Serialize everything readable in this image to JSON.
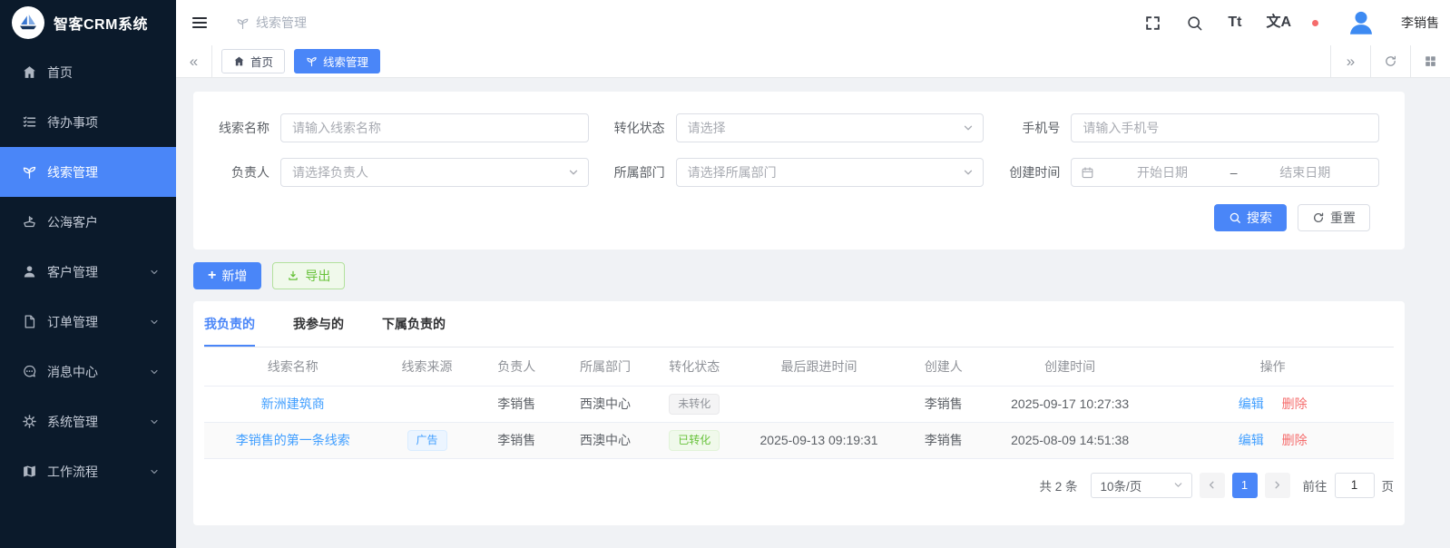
{
  "colors": {
    "primary": "#4a86f8",
    "link": "#409eff",
    "success": "#67c23a",
    "danger": "#f56c6c",
    "sidebar_bg": "#0b1a2b",
    "page_bg": "#f0f2f5"
  },
  "app": {
    "title": "智客CRM系统",
    "logo_icon": "sailboat-icon"
  },
  "sidebar": {
    "items": [
      {
        "label": "首页",
        "icon": "home-icon",
        "active": false,
        "expandable": false
      },
      {
        "label": "待办事项",
        "icon": "todo-list-icon",
        "active": false,
        "expandable": false
      },
      {
        "label": "线索管理",
        "icon": "seedling-icon",
        "active": true,
        "expandable": false
      },
      {
        "label": "公海客户",
        "icon": "ship-icon",
        "active": false,
        "expandable": false
      },
      {
        "label": "客户管理",
        "icon": "user-icon",
        "active": false,
        "expandable": true
      },
      {
        "label": "订单管理",
        "icon": "document-icon",
        "active": false,
        "expandable": true
      },
      {
        "label": "消息中心",
        "icon": "chat-icon",
        "active": false,
        "expandable": true
      },
      {
        "label": "系统管理",
        "icon": "gear-icon",
        "active": false,
        "expandable": true
      },
      {
        "label": "工作流程",
        "icon": "workflow-map-icon",
        "active": false,
        "expandable": true
      }
    ]
  },
  "header": {
    "breadcrumb": "线索管理",
    "font_icon_text": "Tt",
    "lang_icon_text": "文A",
    "username": "李销售",
    "icons": [
      "fullscreen-icon",
      "search-icon",
      "font-size-icon",
      "language-icon",
      "bell-icon",
      "avatar"
    ]
  },
  "tabbar": {
    "collapse_left": "«",
    "collapse_right": "»",
    "tabs": [
      {
        "label": "首页",
        "icon": "home-icon",
        "active": false
      },
      {
        "label": "线索管理",
        "icon": "seedling-icon",
        "active": true
      }
    ],
    "right_icons": [
      "refresh-icon",
      "grid-icon"
    ]
  },
  "filter": {
    "fields": [
      {
        "label": "线索名称",
        "type": "input",
        "placeholder": "请输入线索名称"
      },
      {
        "label": "转化状态",
        "type": "select",
        "placeholder": "请选择"
      },
      {
        "label": "手机号",
        "type": "input",
        "placeholder": "请输入手机号"
      },
      {
        "label": "负责人",
        "type": "select",
        "placeholder": "请选择负责人"
      },
      {
        "label": "所属部门",
        "type": "select",
        "placeholder": "请选择所属部门"
      },
      {
        "label": "创建时间",
        "type": "daterange",
        "start_placeholder": "开始日期",
        "separator": "–",
        "end_placeholder": "结束日期"
      }
    ],
    "search_label": "搜索",
    "reset_label": "重置"
  },
  "actions": {
    "add_label": "新增",
    "plus_glyph": "+",
    "export_label": "导出"
  },
  "panel": {
    "tabs": [
      {
        "label": "我负责的",
        "active": true
      },
      {
        "label": "我参与的",
        "active": false
      },
      {
        "label": "下属负责的",
        "active": false
      }
    ],
    "columns": [
      "线索名称",
      "线索来源",
      "负责人",
      "所属部门",
      "转化状态",
      "最后跟进时间",
      "创建人",
      "创建时间",
      "操作"
    ],
    "rows": [
      {
        "name": "新洲建筑商",
        "source": "",
        "owner": "李销售",
        "department": "西澳中心",
        "status": "未转化",
        "status_type": "info",
        "last_follow": "",
        "creator": "李销售",
        "created_at": "2025-09-17 10:27:33",
        "edit_label": "编辑",
        "delete_label": "删除"
      },
      {
        "name": "李销售的第一条线索",
        "source": "广告",
        "source_type": "primary",
        "owner": "李销售",
        "department": "西澳中心",
        "status": "已转化",
        "status_type": "success",
        "last_follow": "2025-09-13 09:19:31",
        "creator": "李销售",
        "created_at": "2025-08-09 14:51:38",
        "edit_label": "编辑",
        "delete_label": "删除"
      }
    ]
  },
  "pagination": {
    "total_text": "共 2 条",
    "page_size_text": "10条/页",
    "current_page": "1",
    "goto_label": "前往",
    "goto_value": "1",
    "page_unit": "页"
  }
}
